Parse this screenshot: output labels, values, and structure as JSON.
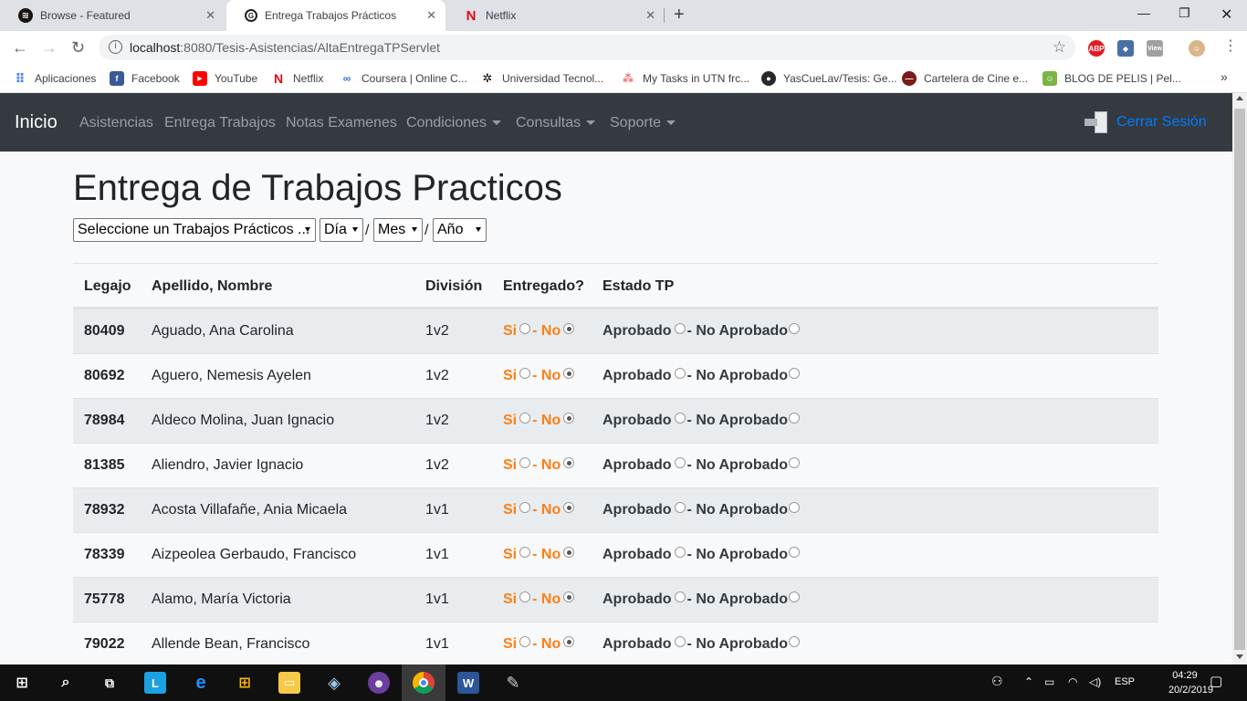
{
  "browser": {
    "tabs": [
      {
        "title": "Browse - Featured",
        "icon": "spotify-icon",
        "color": "#1db954"
      },
      {
        "title": "Entrega Trabajos Prácticos",
        "icon": "globe-icon",
        "color": "#3c4043"
      },
      {
        "title": "Netflix",
        "icon": "netflix-icon",
        "color": "#e50914"
      }
    ],
    "url_host": "localhost",
    "url_path": ":8080/Tesis-Asistencias/AltaEntregaTPServlet",
    "bookmarks": [
      {
        "label": "Aplicaciones",
        "icon": "apps-icon"
      },
      {
        "label": "Facebook",
        "icon": "facebook-icon"
      },
      {
        "label": "YouTube",
        "icon": "youtube-icon"
      },
      {
        "label": "Netflix",
        "icon": "netflix-icon"
      },
      {
        "label": "Coursera | Online C...",
        "icon": "coursera-icon"
      },
      {
        "label": "Universidad Tecnol...",
        "icon": "utn-icon"
      },
      {
        "label": "My Tasks in UTN frc...",
        "icon": "asana-icon"
      },
      {
        "label": "YasCueLav/Tesis: Ge...",
        "icon": "github-icon"
      },
      {
        "label": "Cartelera de Cine e...",
        "icon": "cinema-icon"
      },
      {
        "label": "BLOG DE PELIS | Pel...",
        "icon": "blog-icon"
      }
    ],
    "more_bookmarks": "»"
  },
  "navbar": {
    "brand": "Inicio",
    "links": [
      "Asistencias",
      "Entrega Trabajos",
      "Notas Examenes",
      "Condiciones",
      "Consultas",
      "Soporte"
    ],
    "logout": "Cerrar Sesión"
  },
  "page": {
    "title": "Entrega de Trabajos Practicos",
    "select_tp": "Seleccione un Trabajos Prácticos ...",
    "select_day": "Día",
    "select_month": "Mes",
    "select_year": "Año",
    "sep": "/"
  },
  "table": {
    "headers": [
      "Legajo",
      "Apellido, Nombre",
      "División",
      "Entregado?",
      "Estado TP"
    ],
    "labels": {
      "si": "Si",
      "no": "- No",
      "aprobado": "Aprobado",
      "no_aprobado": "- No Aprobado"
    },
    "rows": [
      {
        "legajo": "80409",
        "nombre": "Aguado, Ana Carolina",
        "division": "1v2"
      },
      {
        "legajo": "80692",
        "nombre": "Aguero, Nemesis Ayelen",
        "division": "1v2"
      },
      {
        "legajo": "78984",
        "nombre": "Aldeco Molina, Juan Ignacio",
        "division": "1v2"
      },
      {
        "legajo": "81385",
        "nombre": "Aliendro, Javier Ignacio",
        "division": "1v2"
      },
      {
        "legajo": "78932",
        "nombre": "Acosta Villafañe, Ania Micaela",
        "division": "1v1"
      },
      {
        "legajo": "78339",
        "nombre": "Aizpeolea Gerbaudo, Francisco",
        "division": "1v1"
      },
      {
        "legajo": "75778",
        "nombre": "Alamo, María Victoria",
        "division": "1v1"
      },
      {
        "legajo": "79022",
        "nombre": "Allende Bean, Francisco",
        "division": "1v1"
      }
    ]
  },
  "taskbar": {
    "lang": "ESP",
    "time": "04:29",
    "date": "20/2/2019"
  },
  "colors": {
    "navbar_bg": "#343a40",
    "accent_orange": "#fd7e14",
    "link_blue": "#007bff"
  }
}
